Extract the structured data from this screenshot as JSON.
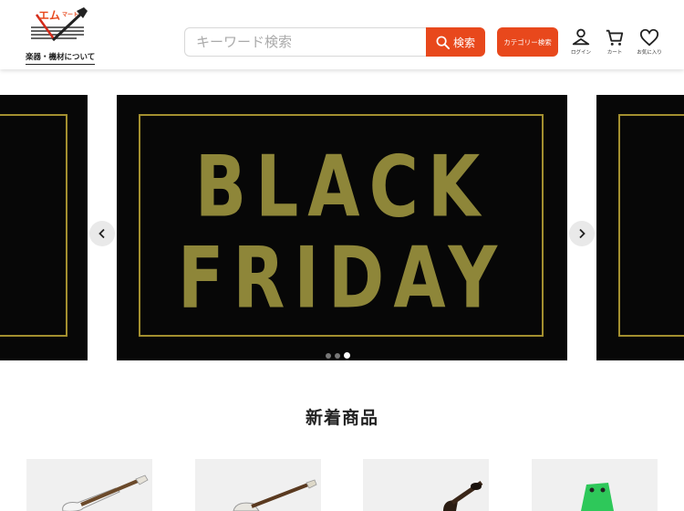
{
  "header": {
    "logo_text": "エムマート",
    "logo_sub": "楽器・機材について",
    "search": {
      "placeholder": "キーワード検索",
      "button_label": "検索"
    },
    "category_button": "カテゴリー検索",
    "icons": [
      {
        "name": "user-icon",
        "label": "ログイン"
      },
      {
        "name": "cart-icon",
        "label": "カート"
      },
      {
        "name": "heart-icon",
        "label": "お気に入り"
      }
    ]
  },
  "carousel": {
    "banner_line1": "BLACK",
    "banner_line2": "FRIDAY",
    "dots": 3,
    "active_dot": 3,
    "colors": {
      "background": "#070707",
      "gold": "#a38f2f",
      "text": "#8e8639"
    }
  },
  "new_products": {
    "title": "新着商品",
    "items": [
      {
        "image": "electric-guitar-white"
      },
      {
        "image": "electric-guitar-sunburst"
      },
      {
        "image": "hollow-body-guitar"
      },
      {
        "image": "green-effects-pedal"
      }
    ]
  },
  "colors": {
    "accent": "#e8481c"
  }
}
